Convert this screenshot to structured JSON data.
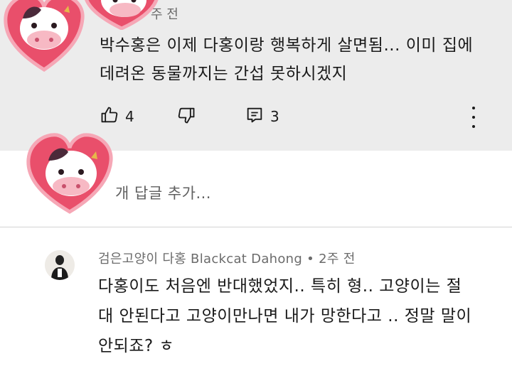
{
  "comment1": {
    "meta": "주 전",
    "text_line1": "박수홍은 이제 다홍이랑 행복하게 살면됨... 이미 집에",
    "text_line2": "데려온 동물까지는 간섭 못하시겠지",
    "likes": "4",
    "replies_count": "3"
  },
  "replies_link": "개 답글 추가...",
  "comment2": {
    "author_meta": "검은고양이 다홍 Blackcat Dahong • 2주 전",
    "text_line1": "다홍이도 처음엔 반대했었지.. 특히 형.. 고양이는 절",
    "text_line2": "대 안된다고 고양이만나면 내가 망한다고 .. 정말 말이",
    "text_line3": "안되죠? ㅎ"
  },
  "icons": {
    "like": "thumbs-up-icon",
    "dislike": "thumbs-down-icon",
    "reply": "reply-comment-icon",
    "more": "more-vertical-icon"
  }
}
